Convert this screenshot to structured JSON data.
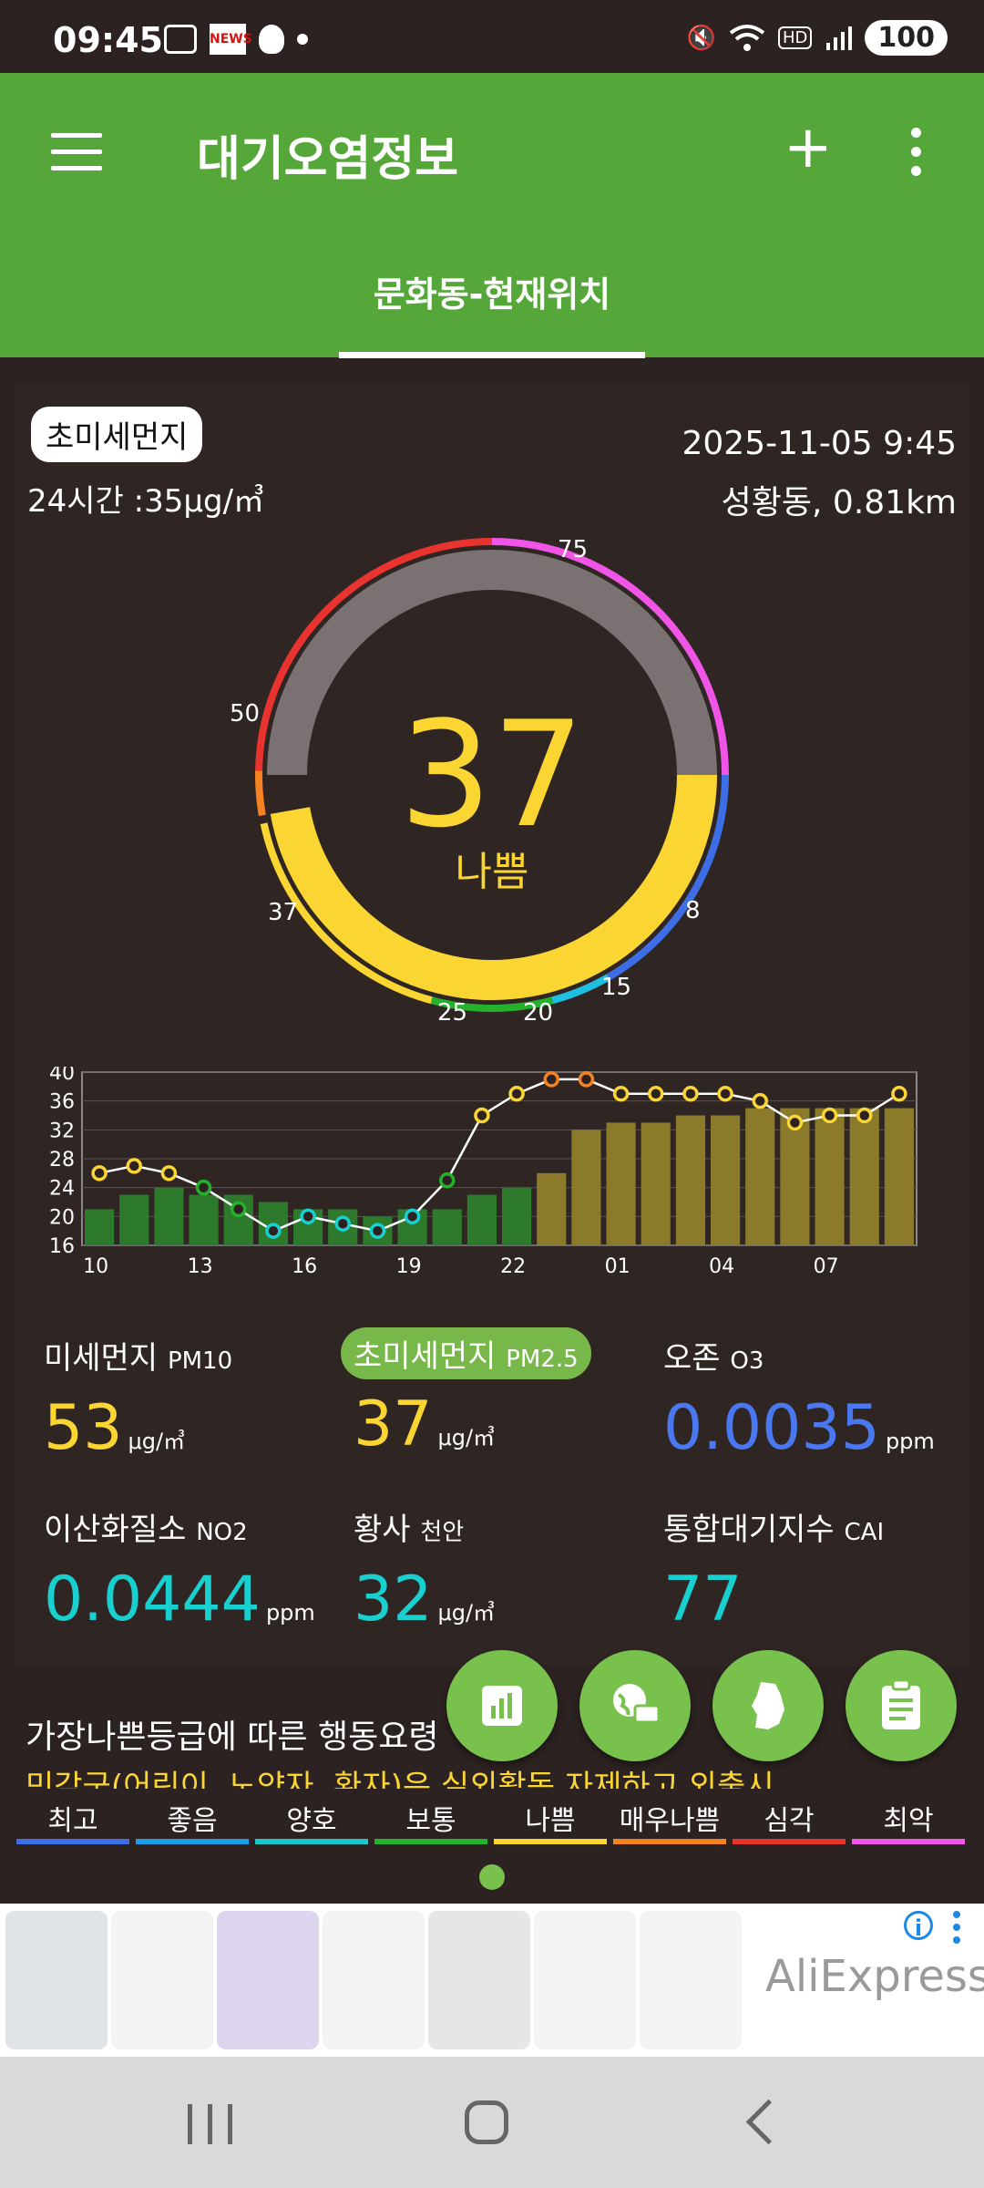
{
  "status_bar": {
    "time": "09:45",
    "battery": "100"
  },
  "app": {
    "title": "대기오염정보",
    "location_tab": "문화동-현재위치"
  },
  "card": {
    "pollutant_pill": "초미세먼지",
    "avg_24h": "24시간 :35μg/㎥",
    "datetime": "2025-11-05 9:45",
    "station": "성황동, 0.81km"
  },
  "gauge": {
    "value": "37",
    "grade": "나쁨",
    "scale_labels": {
      "l75": "75",
      "l50": "50",
      "l37": "37",
      "l25": "25",
      "l20": "20",
      "l15": "15",
      "l8": "8"
    },
    "current_value": 37,
    "colors": {
      "very_good": "#3d6ee6",
      "good": "#1fbfe0",
      "fine": "#19d0d0",
      "normal": "#25b12c",
      "bad": "#fbd531",
      "very_bad": "#f58220",
      "serious": "#e8332f",
      "worst": "#f055e8"
    }
  },
  "chart_data": {
    "type": "bar",
    "categories": [
      "10",
      "",
      "",
      "13",
      "",
      "",
      "16",
      "",
      "",
      "19",
      "",
      "",
      "22",
      "",
      "",
      "01",
      "",
      "",
      "04",
      "",
      "",
      "07",
      "",
      ""
    ],
    "y_ticks": [
      "40",
      "36",
      "32",
      "28",
      "24",
      "20",
      "16"
    ],
    "ylim": [
      16,
      40
    ],
    "series": [
      {
        "values": [
          21,
          23,
          24,
          23,
          23,
          22,
          21,
          21,
          20,
          21,
          21,
          23,
          24,
          26,
          32,
          33,
          33,
          34,
          34,
          35,
          35,
          35,
          35,
          35
        ]
      },
      {
        "values": [
          26,
          27,
          26,
          24,
          21,
          18,
          20,
          19,
          18,
          20,
          25,
          34,
          37,
          39,
          39,
          37,
          37,
          37,
          37,
          36,
          33,
          34,
          34,
          37
        ]
      }
    ]
  },
  "metrics": [
    {
      "name": "미세먼지",
      "sub": "PM10",
      "value": "53",
      "unit": "μg/㎥",
      "color": "#fbd531"
    },
    {
      "name": "초미세먼지",
      "sub": "PM2.5",
      "value": "37",
      "unit": "μg/㎥",
      "color": "#fbd531"
    },
    {
      "name": "오존",
      "sub": "O3",
      "value": "0.0035",
      "unit": "ppm",
      "color": "#4a78f0"
    },
    {
      "name": "이산화질소",
      "sub": "NO2",
      "value": "0.0444",
      "unit": "ppm",
      "color": "#19d0d0"
    },
    {
      "name": "황사",
      "sub": "천안",
      "value": "32",
      "unit": "μg/㎥",
      "color": "#19d0d0"
    },
    {
      "name": "통합대기지수",
      "sub": "CAI",
      "value": "77",
      "unit": "",
      "color": "#19d0d0"
    }
  ],
  "guide": {
    "title": "가장나쁜등급에 따른 행동요령",
    "text": "민감군(어린이, 노약자, 환자)은 실외활동 자제하고 외출시"
  },
  "fab_icons": [
    "bar-chart-icon",
    "globe-chat-icon",
    "korea-map-icon",
    "clipboard-icon"
  ],
  "legend": [
    {
      "label": "최고",
      "color": "#3d6ee6"
    },
    {
      "label": "좋음",
      "color": "#1e9be8"
    },
    {
      "label": "양호",
      "color": "#19c8c8"
    },
    {
      "label": "보통",
      "color": "#25b12c"
    },
    {
      "label": "나쁨",
      "color": "#fbd531"
    },
    {
      "label": "매우나쁨",
      "color": "#f58220"
    },
    {
      "label": "심각",
      "color": "#e8332f"
    },
    {
      "label": "최악",
      "color": "#f055e8"
    }
  ],
  "ad": {
    "brand": "AliExpress",
    "info": "i"
  }
}
